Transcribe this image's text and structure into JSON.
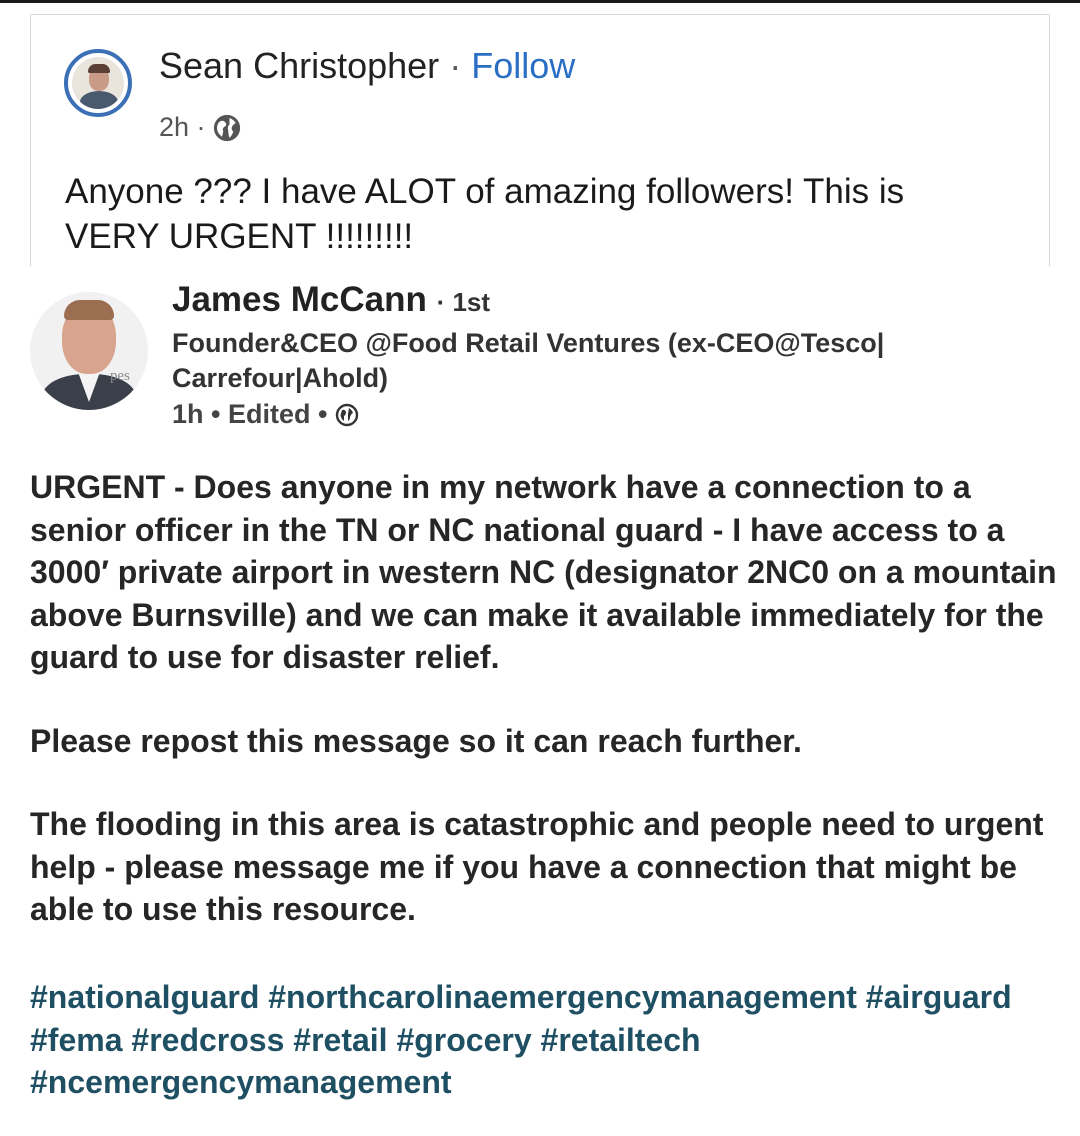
{
  "outer_post": {
    "author": "Sean Christopher",
    "separator": "·",
    "follow_label": "Follow",
    "time": "2h ·",
    "visibility_icon": "globe-icon",
    "text_line1": "Anyone ??? I have ALOT of amazing followers! This is",
    "text_line2": "VERY URGENT !!!!!!!!!"
  },
  "shared_post": {
    "author": "James McCann",
    "connection": " · 1st",
    "title_line1": "Founder&CEO @Food Retail Ventures (ex-CEO@Tesco|",
    "title_line2": "Carrefour|Ahold)",
    "meta": "1h • Edited •",
    "visibility_icon": "globe-icon",
    "avatar_overlay_text": "pes",
    "paragraphs": [
      "URGENT - Does anyone in my network have a connection to a senior officer in the TN or NC national guard - I have access to a 3000′ private airport in western NC (designator 2NC0 on a mountain above Burnsville) and we can make it available immediately for the guard to use for disaster relief.",
      "Please repost this message so it can reach further.",
      "The flooding in this area is catastrophic and people need to urgent help - please message me if you have a connection that might be able to use this resource."
    ],
    "hashtags": [
      "#nationalguard",
      "#northcarolinaemergencymanagement",
      "#airguard",
      "#fema",
      "#redcross",
      "#retail",
      "#grocery",
      "#retailtech",
      "#ncemergencymanagement"
    ]
  },
  "colors": {
    "follow_link": "#2a6fc4",
    "hashtag": "#1f4f63",
    "avatar_ring": "#3b6fb6"
  }
}
